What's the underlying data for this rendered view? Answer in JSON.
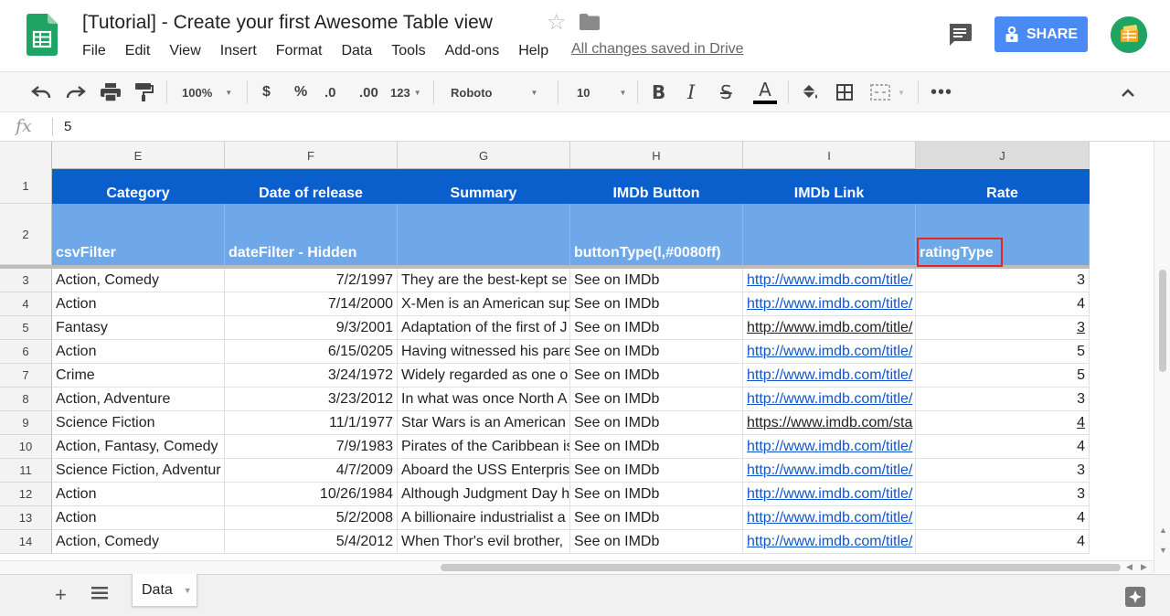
{
  "window": {
    "title": "[Tutorial] - Create your first Awesome Table view",
    "save_status": "All changes saved in Drive",
    "share_label": "SHARE"
  },
  "menu": [
    "File",
    "Edit",
    "View",
    "Insert",
    "Format",
    "Data",
    "Tools",
    "Add-ons",
    "Help"
  ],
  "toolbar": {
    "zoom": "100%",
    "currency": "$",
    "percent": "%",
    "decrease_decimals": ".0",
    "increase_decimals": ".00",
    "more_formats": "123",
    "font": "Roboto",
    "font_size": "10"
  },
  "formula_bar": {
    "fx": "fx",
    "value": "5"
  },
  "grid": {
    "columns": [
      "E",
      "F",
      "G",
      "H",
      "I",
      "J"
    ],
    "selected_column": "J",
    "header_row": [
      "Category",
      "Date of release",
      "Summary",
      "IMDb Button",
      "IMDb Link",
      "Rate"
    ],
    "filter_row": [
      "csvFilter",
      "dateFilter - Hidden",
      "",
      "buttonType(l,#0080ff)",
      "",
      "ratingType"
    ],
    "row_numbers": [
      "1",
      "2",
      "3",
      "4",
      "5",
      "6",
      "7",
      "8",
      "9",
      "10",
      "11",
      "12",
      "13",
      "14"
    ],
    "rows": [
      [
        "Action, Comedy",
        "7/2/1997",
        "They are the best-kept se",
        "See on IMDb",
        "http://www.imdb.com/title/",
        "3"
      ],
      [
        "Action",
        "7/14/2000",
        "X-Men is an American sup",
        "See on IMDb",
        "http://www.imdb.com/title/",
        "4"
      ],
      [
        "Fantasy",
        "9/3/2001",
        "Adaptation of the first of J",
        "See on IMDb",
        "http://www.imdb.com/title/",
        "3"
      ],
      [
        "Action",
        "6/15/0205",
        "Having witnessed his pare",
        "See on IMDb",
        "http://www.imdb.com/title/",
        "5"
      ],
      [
        "Crime",
        "3/24/1972",
        "Widely regarded as one o",
        "See on IMDb",
        "http://www.imdb.com/title/",
        "5"
      ],
      [
        "Action, Adventure",
        "3/23/2012",
        "In what was once North A",
        "See on IMDb",
        "http://www.imdb.com/title/",
        "3"
      ],
      [
        "Science Fiction",
        "11/1/1977",
        "Star Wars is an American",
        "See on IMDb",
        "https://www.imdb.com/sta",
        "4"
      ],
      [
        "Action, Fantasy, Comedy",
        "7/9/1983",
        "Pirates of the Caribbean is",
        "See on IMDb",
        "http://www.imdb.com/title/",
        "4"
      ],
      [
        "Science Fiction, Adventur",
        "4/7/2009",
        "Aboard the USS Enterpris",
        "See on IMDb",
        "http://www.imdb.com/title/",
        "3"
      ],
      [
        "Action",
        "10/26/1984",
        "Although Judgment Day h",
        "See on IMDb",
        "http://www.imdb.com/title/",
        "3"
      ],
      [
        "Action",
        "5/2/2008",
        "A billionaire industrialist a",
        "See on IMDb",
        "http://www.imdb.com/title/",
        "4"
      ],
      [
        "Action, Comedy",
        "5/4/2012",
        "When Thor's evil brother,",
        "See on IMDb",
        "http://www.imdb.com/title/",
        "4"
      ]
    ],
    "link_styles": [
      "link",
      "link",
      "ulink",
      "link",
      "link",
      "link",
      "ulink",
      "link",
      "link",
      "link",
      "link",
      "link"
    ],
    "rate_underlined": [
      false,
      false,
      true,
      false,
      false,
      false,
      true,
      false,
      false,
      false,
      false,
      false
    ]
  },
  "sheets": {
    "active": "Data"
  },
  "colors": {
    "header_blue": "#0b5fcc",
    "subheader_blue": "#6fa8e8",
    "link": "#1155cc",
    "highlight": "#e02828",
    "share": "#4a8af4",
    "sheets_green": "#1fa463"
  }
}
